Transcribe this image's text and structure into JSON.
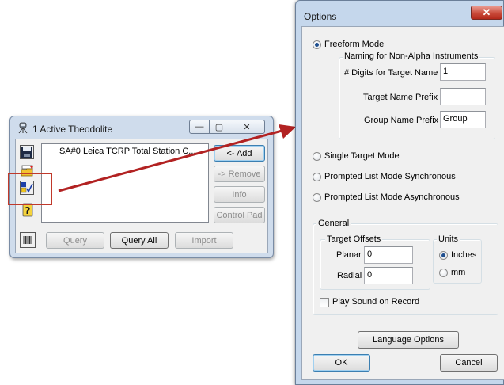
{
  "theodolite": {
    "title": "1 Active Theodolite",
    "list_items": [
      "SA#0  Leica TCRP Total Station  C..."
    ],
    "buttons": {
      "add": "<- Add",
      "remove": "-> Remove",
      "info": "Info",
      "control_pad": "Control Pad"
    },
    "bottom_buttons": {
      "query": "Query",
      "query_all": "Query All",
      "import": "Import"
    },
    "toolbar_icons": [
      "save-icon",
      "open-folder-icon",
      "instrument-check-icon",
      "help-icon"
    ],
    "caption": {
      "minimize": "—",
      "restore": "▢",
      "close": "✕"
    }
  },
  "options": {
    "title": "Options",
    "close": "✕",
    "freeform_mode": "Freeform Mode",
    "naming_group": "Naming for Non-Alpha Instruments",
    "digits_label": "# Digits for Target Name",
    "digits_value": "1",
    "target_prefix_label": "Target Name Prefix",
    "target_prefix_value": "",
    "group_prefix_label": "Group Name Prefix",
    "group_prefix_value": "Group",
    "single_target": "Single Target Mode",
    "prompted_sync": "Prompted List Mode Synchronous",
    "prompted_async": "Prompted List Mode Asynchronous",
    "general_group": "General",
    "target_offsets_group": "Target Offsets",
    "planar_label": "Planar",
    "planar_value": "0",
    "radial_label": "Radial",
    "radial_value": "0",
    "units_group": "Units",
    "inches": "Inches",
    "mm": "mm",
    "play_sound": "Play Sound on Record",
    "language_options": "Language Options",
    "ok": "OK",
    "cancel": "Cancel",
    "selected_mode": "freeform",
    "selected_unit": "inches",
    "play_sound_checked": false
  },
  "colors": {
    "highlight_box": "#c0392b",
    "arrow": "#b22222"
  }
}
